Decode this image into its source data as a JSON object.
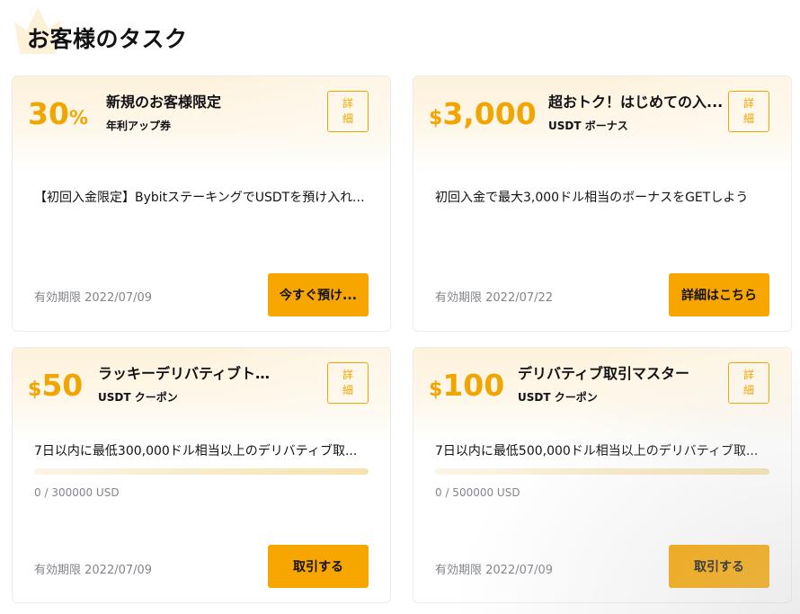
{
  "page": {
    "title": "お客様のタスク"
  },
  "colors": {
    "accent": "#f7a600",
    "amount": "#f0a500",
    "muted": "#81858c"
  },
  "cards": [
    {
      "amount_prefix": "",
      "amount_value": "30",
      "amount_suffix": "%",
      "title": "新規のお客様限定",
      "subtitle": "年利アップ券",
      "detail_label": "詳細",
      "description": "【初回入金限定】BybitステーキングでUSDTを預け入れて...",
      "expiry": "有効期限 2022/07/09",
      "button_label": "今すぐ預け..."
    },
    {
      "amount_prefix": "$",
      "amount_value": "3,000",
      "amount_suffix": "",
      "title": "超おトク！はじめての入...",
      "subtitle": "USDT ボーナス",
      "detail_label": "詳細",
      "description": "初回入金で最大3,000ドル相当のボーナスをGETしよう",
      "expiry": "有効期限 2022/07/22",
      "button_label": "詳細はこちら"
    },
    {
      "amount_prefix": "$",
      "amount_value": "50",
      "amount_suffix": "",
      "title": "ラッキーデリバティブトレーダ",
      "subtitle": "USDT クーポン",
      "detail_label": "詳細",
      "description": "7日以内に最低300,000ドル相当以上のデリバティブ取...",
      "progress_text": "0 / 300000 USD",
      "progress_fraction": 0,
      "expiry": "有効期限 2022/07/09",
      "button_label": "取引する"
    },
    {
      "amount_prefix": "$",
      "amount_value": "100",
      "amount_suffix": "",
      "title": "デリバティブ取引マスター",
      "subtitle": "USDT クーポン",
      "detail_label": "詳細",
      "description": "7日以内に最低500,000ドル相当以上のデリバティブ取...",
      "progress_text": "0 / 500000 USD",
      "progress_fraction": 0,
      "expiry": "有効期限 2022/07/09",
      "button_label": "取引する"
    }
  ],
  "icons": {
    "decoration": "crown-icon"
  }
}
